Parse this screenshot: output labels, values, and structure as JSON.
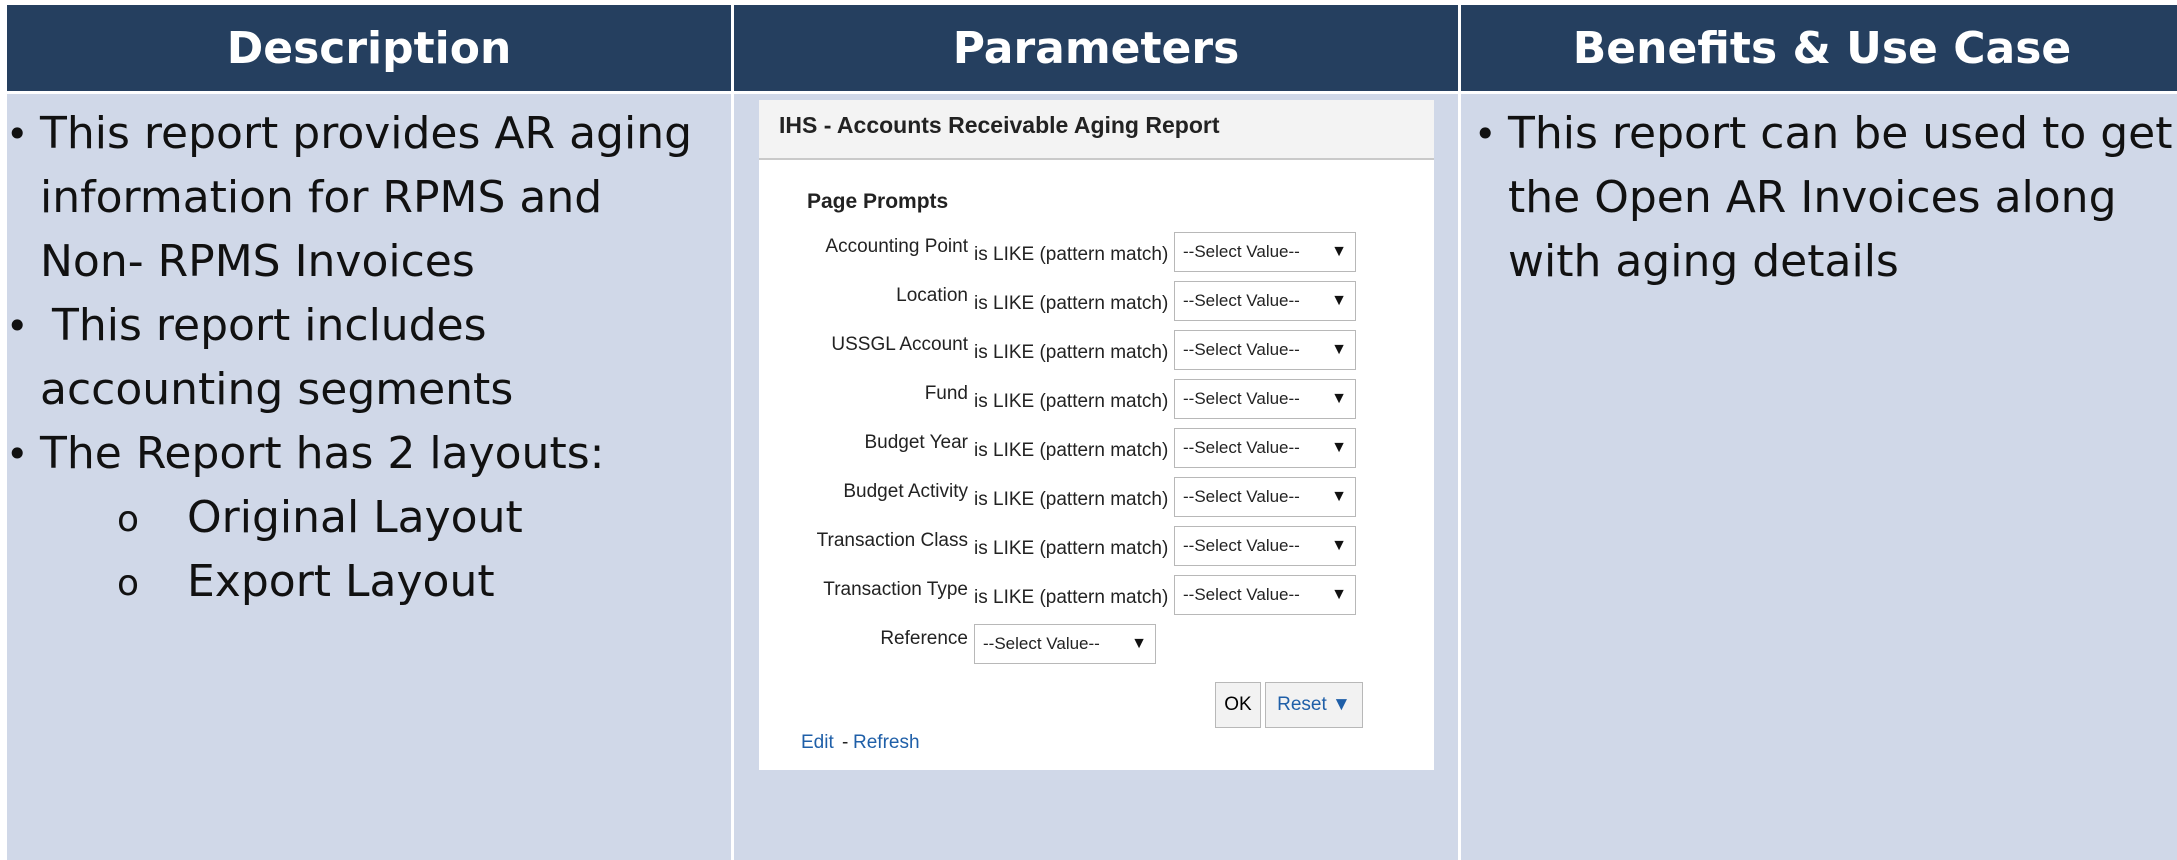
{
  "headers": {
    "description": "Description",
    "parameters": "Parameters",
    "benefits": "Benefits & Use Case"
  },
  "description": {
    "bullets": [
      [
        "This report provides AR aging",
        "information for RPMS and",
        "Non- RPMS Invoices"
      ],
      [
        "This report includes",
        "accounting segments"
      ],
      [
        "The Report has 2 layouts:"
      ]
    ],
    "sub_items": [
      "Original Layout",
      "Export Layout"
    ],
    "bullet_symbol": "•",
    "sub_symbol": "o"
  },
  "benefits": {
    "lines": [
      "This report can be used to get",
      "the Open AR Invoices along",
      "with aging details"
    ]
  },
  "report": {
    "title": "IHS - Accounts Receivable Aging Report",
    "section": "Page Prompts",
    "operator": "is LIKE (pattern match)",
    "select_placeholder": "--Select Value--",
    "arrow": "▼",
    "prompts": [
      "Accounting Point",
      "Location",
      "USSGL Account",
      "Fund",
      "Budget Year",
      "Budget Activity",
      "Transaction Class",
      "Transaction Type"
    ],
    "reference_label": "Reference",
    "ok_label": "OK",
    "reset_label": "Reset ▼",
    "edit_label": "Edit",
    "separator": "-",
    "refresh_label": "Refresh"
  },
  "colors": {
    "header_bg": "#253f5f",
    "cell_bg": "#d0d8e8",
    "link": "#1f5fa8"
  }
}
